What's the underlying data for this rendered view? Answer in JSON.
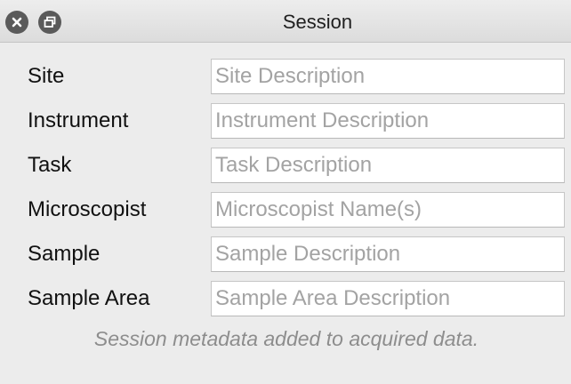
{
  "window": {
    "title": "Session",
    "close_icon": "close-icon",
    "float_icon": "float-window-icon"
  },
  "fields": [
    {
      "label": "Site",
      "placeholder": "Site Description",
      "value": ""
    },
    {
      "label": "Instrument",
      "placeholder": "Instrument Description",
      "value": ""
    },
    {
      "label": "Task",
      "placeholder": "Task Description",
      "value": ""
    },
    {
      "label": "Microscopist",
      "placeholder": "Microscopist Name(s)",
      "value": ""
    },
    {
      "label": "Sample",
      "placeholder": "Sample Description",
      "value": ""
    },
    {
      "label": "Sample Area",
      "placeholder": "Sample Area Description",
      "value": ""
    }
  ],
  "note": "Session metadata added to acquired data.",
  "colors": {
    "titlebar_button": "#5a5a5a",
    "placeholder": "#a3a3a3",
    "note": "#8d8d8d"
  }
}
